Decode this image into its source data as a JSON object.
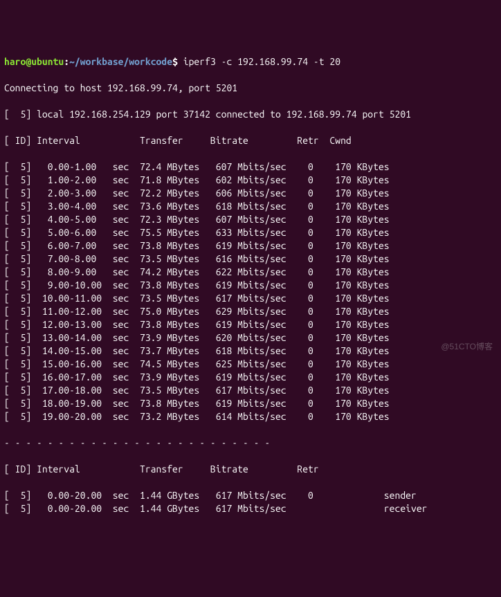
{
  "prompt": {
    "user_host": "haro@ubuntu",
    "path": "~/workbase/workcode",
    "symbol": "$",
    "command": "iperf3 -c 192.168.99.74 -t 20"
  },
  "connecting_line": "Connecting to host 192.168.99.74, port 5201",
  "local_line": "[  5] local 192.168.254.129 port 37142 connected to 192.168.99.74 port 5201",
  "header1": "[ ID] Interval           Transfer     Bitrate         Retr  Cwnd",
  "rows": [
    "[  5]   0.00-1.00   sec  72.4 MBytes   607 Mbits/sec    0    170 KBytes       ",
    "[  5]   1.00-2.00   sec  71.8 MBytes   602 Mbits/sec    0    170 KBytes       ",
    "[  5]   2.00-3.00   sec  72.2 MBytes   606 Mbits/sec    0    170 KBytes       ",
    "[  5]   3.00-4.00   sec  73.6 MBytes   618 Mbits/sec    0    170 KBytes       ",
    "[  5]   4.00-5.00   sec  72.3 MBytes   607 Mbits/sec    0    170 KBytes       ",
    "[  5]   5.00-6.00   sec  75.5 MBytes   633 Mbits/sec    0    170 KBytes       ",
    "[  5]   6.00-7.00   sec  73.8 MBytes   619 Mbits/sec    0    170 KBytes       ",
    "[  5]   7.00-8.00   sec  73.5 MBytes   616 Mbits/sec    0    170 KBytes       ",
    "[  5]   8.00-9.00   sec  74.2 MBytes   622 Mbits/sec    0    170 KBytes       ",
    "[  5]   9.00-10.00  sec  73.8 MBytes   619 Mbits/sec    0    170 KBytes       ",
    "[  5]  10.00-11.00  sec  73.5 MBytes   617 Mbits/sec    0    170 KBytes       ",
    "[  5]  11.00-12.00  sec  75.0 MBytes   629 Mbits/sec    0    170 KBytes       ",
    "[  5]  12.00-13.00  sec  73.8 MBytes   619 Mbits/sec    0    170 KBytes       ",
    "[  5]  13.00-14.00  sec  73.9 MBytes   620 Mbits/sec    0    170 KBytes       ",
    "[  5]  14.00-15.00  sec  73.7 MBytes   618 Mbits/sec    0    170 KBytes       ",
    "[  5]  15.00-16.00  sec  74.5 MBytes   625 Mbits/sec    0    170 KBytes       ",
    "[  5]  16.00-17.00  sec  73.9 MBytes   619 Mbits/sec    0    170 KBytes       ",
    "[  5]  17.00-18.00  sec  73.5 MBytes   617 Mbits/sec    0    170 KBytes       ",
    "[  5]  18.00-19.00  sec  73.8 MBytes   619 Mbits/sec    0    170 KBytes       ",
    "[  5]  19.00-20.00  sec  73.2 MBytes   614 Mbits/sec    0    170 KBytes       "
  ],
  "separator": "- - - - - - - - - - - - - - - - - - - - - - - - -",
  "header2": "[ ID] Interval           Transfer     Bitrate         Retr",
  "summary": [
    "[  5]   0.00-20.00  sec  1.44 GBytes   617 Mbits/sec    0             sender",
    "[  5]   0.00-20.00  sec  1.44 GBytes   617 Mbits/sec                  receiver"
  ],
  "chart_data": {
    "type": "table",
    "title": "iperf3 client output",
    "columns": [
      "ID",
      "Interval",
      "Transfer",
      "Bitrate",
      "Retr",
      "Cwnd"
    ],
    "intervals": [
      {
        "id": 5,
        "start": 0.0,
        "end": 1.0,
        "transfer_mbytes": 72.4,
        "bitrate_mbits_s": 607,
        "retr": 0,
        "cwnd_kbytes": 170
      },
      {
        "id": 5,
        "start": 1.0,
        "end": 2.0,
        "transfer_mbytes": 71.8,
        "bitrate_mbits_s": 602,
        "retr": 0,
        "cwnd_kbytes": 170
      },
      {
        "id": 5,
        "start": 2.0,
        "end": 3.0,
        "transfer_mbytes": 72.2,
        "bitrate_mbits_s": 606,
        "retr": 0,
        "cwnd_kbytes": 170
      },
      {
        "id": 5,
        "start": 3.0,
        "end": 4.0,
        "transfer_mbytes": 73.6,
        "bitrate_mbits_s": 618,
        "retr": 0,
        "cwnd_kbytes": 170
      },
      {
        "id": 5,
        "start": 4.0,
        "end": 5.0,
        "transfer_mbytes": 72.3,
        "bitrate_mbits_s": 607,
        "retr": 0,
        "cwnd_kbytes": 170
      },
      {
        "id": 5,
        "start": 5.0,
        "end": 6.0,
        "transfer_mbytes": 75.5,
        "bitrate_mbits_s": 633,
        "retr": 0,
        "cwnd_kbytes": 170
      },
      {
        "id": 5,
        "start": 6.0,
        "end": 7.0,
        "transfer_mbytes": 73.8,
        "bitrate_mbits_s": 619,
        "retr": 0,
        "cwnd_kbytes": 170
      },
      {
        "id": 5,
        "start": 7.0,
        "end": 8.0,
        "transfer_mbytes": 73.5,
        "bitrate_mbits_s": 616,
        "retr": 0,
        "cwnd_kbytes": 170
      },
      {
        "id": 5,
        "start": 8.0,
        "end": 9.0,
        "transfer_mbytes": 74.2,
        "bitrate_mbits_s": 622,
        "retr": 0,
        "cwnd_kbytes": 170
      },
      {
        "id": 5,
        "start": 9.0,
        "end": 10.0,
        "transfer_mbytes": 73.8,
        "bitrate_mbits_s": 619,
        "retr": 0,
        "cwnd_kbytes": 170
      },
      {
        "id": 5,
        "start": 10.0,
        "end": 11.0,
        "transfer_mbytes": 73.5,
        "bitrate_mbits_s": 617,
        "retr": 0,
        "cwnd_kbytes": 170
      },
      {
        "id": 5,
        "start": 11.0,
        "end": 12.0,
        "transfer_mbytes": 75.0,
        "bitrate_mbits_s": 629,
        "retr": 0,
        "cwnd_kbytes": 170
      },
      {
        "id": 5,
        "start": 12.0,
        "end": 13.0,
        "transfer_mbytes": 73.8,
        "bitrate_mbits_s": 619,
        "retr": 0,
        "cwnd_kbytes": 170
      },
      {
        "id": 5,
        "start": 13.0,
        "end": 14.0,
        "transfer_mbytes": 73.9,
        "bitrate_mbits_s": 620,
        "retr": 0,
        "cwnd_kbytes": 170
      },
      {
        "id": 5,
        "start": 14.0,
        "end": 15.0,
        "transfer_mbytes": 73.7,
        "bitrate_mbits_s": 618,
        "retr": 0,
        "cwnd_kbytes": 170
      },
      {
        "id": 5,
        "start": 15.0,
        "end": 16.0,
        "transfer_mbytes": 74.5,
        "bitrate_mbits_s": 625,
        "retr": 0,
        "cwnd_kbytes": 170
      },
      {
        "id": 5,
        "start": 16.0,
        "end": 17.0,
        "transfer_mbytes": 73.9,
        "bitrate_mbits_s": 619,
        "retr": 0,
        "cwnd_kbytes": 170
      },
      {
        "id": 5,
        "start": 17.0,
        "end": 18.0,
        "transfer_mbytes": 73.5,
        "bitrate_mbits_s": 617,
        "retr": 0,
        "cwnd_kbytes": 170
      },
      {
        "id": 5,
        "start": 18.0,
        "end": 19.0,
        "transfer_mbytes": 73.8,
        "bitrate_mbits_s": 619,
        "retr": 0,
        "cwnd_kbytes": 170
      },
      {
        "id": 5,
        "start": 19.0,
        "end": 20.0,
        "transfer_mbytes": 73.2,
        "bitrate_mbits_s": 614,
        "retr": 0,
        "cwnd_kbytes": 170
      }
    ],
    "summary": [
      {
        "id": 5,
        "start": 0.0,
        "end": 20.0,
        "transfer_gbytes": 1.44,
        "bitrate_mbits_s": 617,
        "retr": 0,
        "role": "sender"
      },
      {
        "id": 5,
        "start": 0.0,
        "end": 20.0,
        "transfer_gbytes": 1.44,
        "bitrate_mbits_s": 617,
        "role": "receiver"
      }
    ]
  },
  "watermark": "@51CTO博客"
}
